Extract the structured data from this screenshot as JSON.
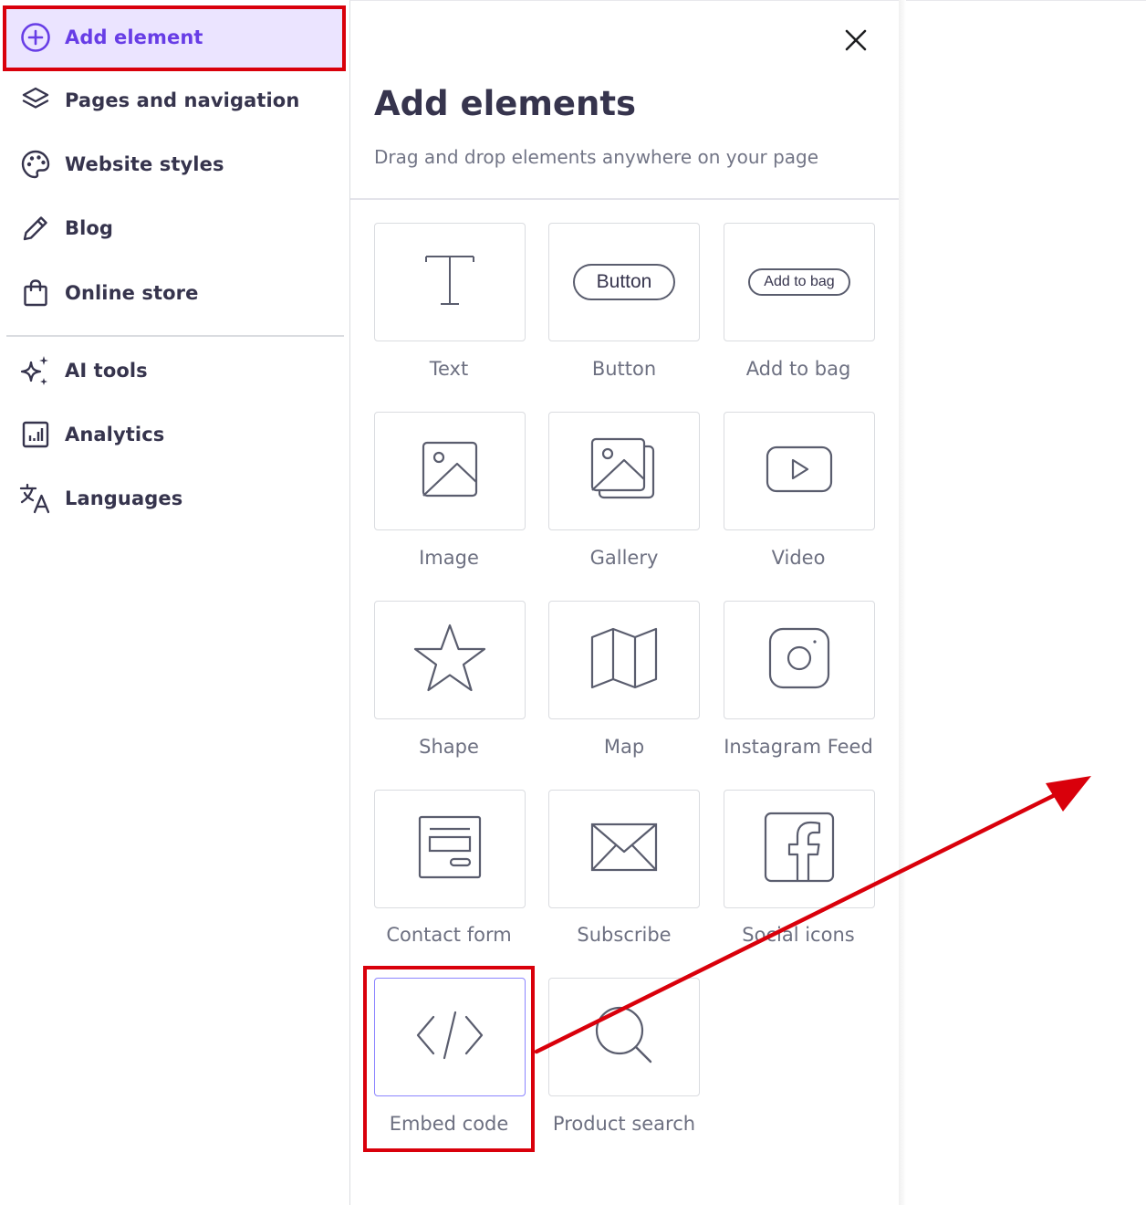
{
  "sidebar": {
    "items": [
      {
        "label": "Add element",
        "icon": "plus-circle-icon",
        "active": true
      },
      {
        "label": "Pages and navigation",
        "icon": "layers-icon"
      },
      {
        "label": "Website styles",
        "icon": "palette-icon"
      },
      {
        "label": "Blog",
        "icon": "pencil-icon"
      },
      {
        "label": "Online store",
        "icon": "shopping-bag-icon"
      },
      {
        "label": "AI tools",
        "icon": "sparkles-icon"
      },
      {
        "label": "Analytics",
        "icon": "analytics-icon"
      },
      {
        "label": "Languages",
        "icon": "translate-icon"
      }
    ]
  },
  "panel": {
    "title": "Add elements",
    "subtitle": "Drag and drop elements anywhere on your page",
    "close_icon": "close-icon",
    "elements": [
      {
        "label": "Text",
        "icon": "text-icon"
      },
      {
        "label": "Button",
        "icon": "button-pill-icon",
        "preview": "Button"
      },
      {
        "label": "Add to bag",
        "icon": "add-to-bag-pill-icon",
        "preview": "Add to bag"
      },
      {
        "label": "Image",
        "icon": "image-icon"
      },
      {
        "label": "Gallery",
        "icon": "gallery-icon"
      },
      {
        "label": "Video",
        "icon": "video-icon"
      },
      {
        "label": "Shape",
        "icon": "star-icon"
      },
      {
        "label": "Map",
        "icon": "map-icon"
      },
      {
        "label": "Instagram Feed",
        "icon": "instagram-icon"
      },
      {
        "label": "Contact form",
        "icon": "contact-form-icon"
      },
      {
        "label": "Subscribe",
        "icon": "envelope-icon"
      },
      {
        "label": "Social icons",
        "icon": "facebook-icon"
      },
      {
        "label": "Embed code",
        "icon": "code-icon",
        "selected": true
      },
      {
        "label": "Product search",
        "icon": "search-icon"
      }
    ]
  },
  "colors": {
    "accent": "#673de6",
    "active_bg": "#ebe4ff",
    "annotation": "#d9000b",
    "nav_text": "#36344d",
    "tile_label": "#6d7081"
  }
}
